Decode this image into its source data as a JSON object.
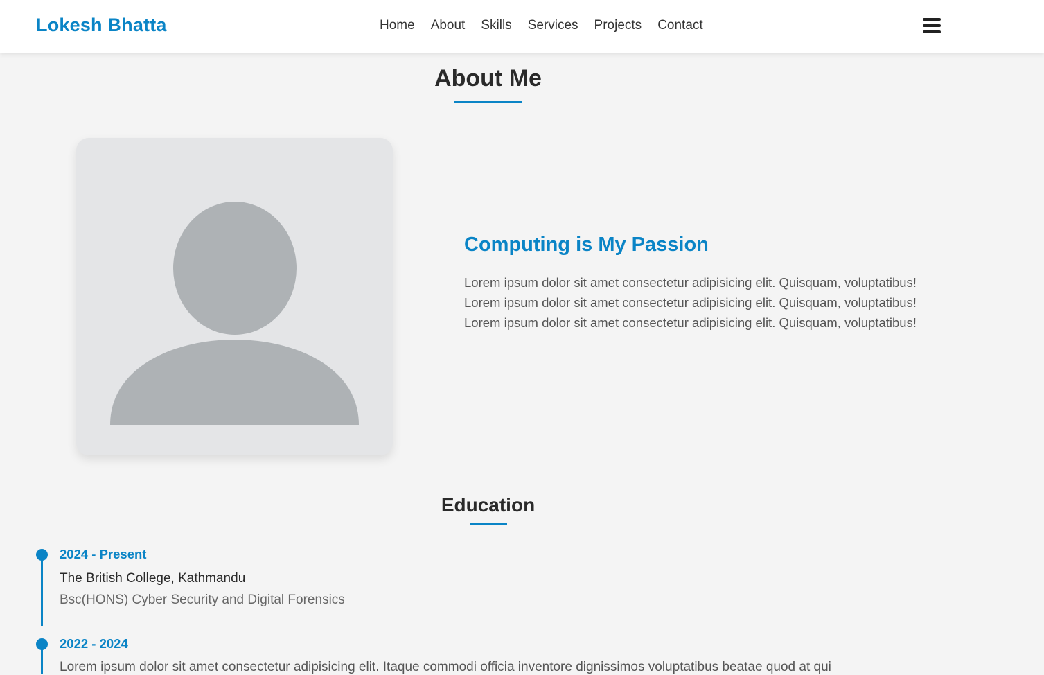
{
  "navbar": {
    "brand": "Lokesh Bhatta",
    "links": [
      "Home",
      "About",
      "Skills",
      "Services",
      "Projects",
      "Contact"
    ],
    "menu_icon": "hamburger-icon"
  },
  "about": {
    "title": "About Me",
    "photo_icon": "user-avatar-placeholder-icon",
    "heading": "Computing is My Passion",
    "text": "Lorem ipsum dolor sit amet consectetur adipisicing elit. Quisquam, voluptatibus! Lorem ipsum dolor sit amet consectetur adipisicing elit. Quisquam, voluptatibus! Lorem ipsum dolor sit amet consectetur adipisicing elit. Quisquam, voluptatibus!"
  },
  "education": {
    "title": "Education",
    "items": [
      {
        "date": "2024 - Present",
        "school": "The British College, Kathmandu",
        "degree": "Bsc(HONS) Cyber Security and Digital Forensics"
      },
      {
        "date": "2022 - 2024",
        "description": "Lorem ipsum dolor sit amet consectetur adipisicing elit. Itaque commodi officia inventore dignissimos voluptatibus beatae quod at qui"
      }
    ]
  },
  "colors": {
    "accent": "#0a84c6",
    "background": "#f4f4f4",
    "card": "#e4e5e7",
    "avatar": "#aeb2b5"
  }
}
